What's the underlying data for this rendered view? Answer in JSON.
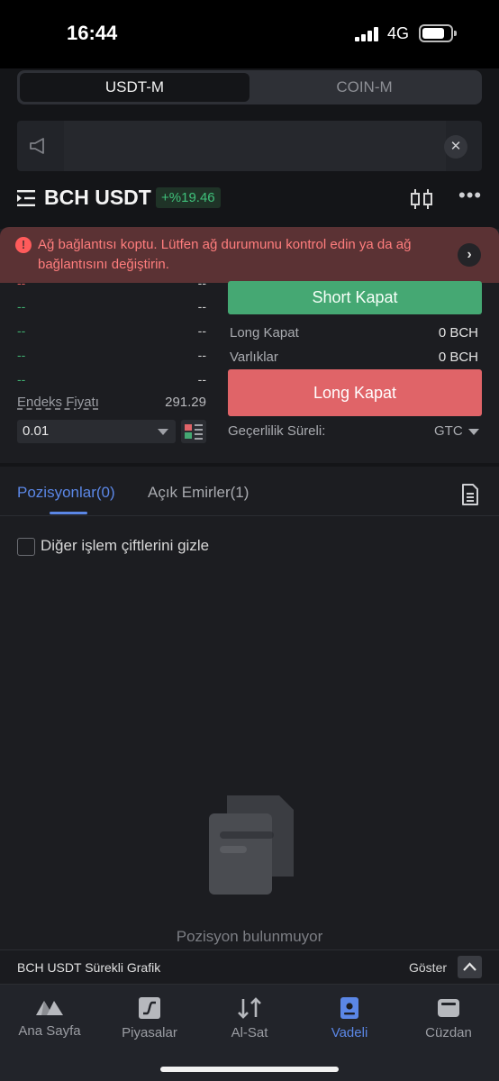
{
  "status_bar": {
    "time": "16:44",
    "network": "4G"
  },
  "segment": {
    "tabs": [
      "USDT-M",
      "COIN-M"
    ],
    "active": "USDT-M"
  },
  "announcement": {
    "close_symbol": "✕"
  },
  "pair": {
    "name": "BCH USDT",
    "change": "+%19.46"
  },
  "alert": {
    "message": "Ağ bağlantısı koptu. Lütfen ağ durumunu kontrol edin ya da ağ bağlantısını değiştirin.",
    "icon_symbol": "!",
    "arrow_symbol": "›"
  },
  "order_book": {
    "rows": [
      {
        "price": "--",
        "amount": "--",
        "side": "sell"
      },
      {
        "price": "--",
        "amount": "--",
        "side": "buy"
      },
      {
        "price": "--",
        "amount": "--",
        "side": "buy"
      },
      {
        "price": "--",
        "amount": "--",
        "side": "buy"
      },
      {
        "price": "--",
        "amount": "--",
        "side": "buy"
      }
    ],
    "index_label": "Endeks Fiyatı",
    "index_value": "291.29",
    "depth": "0.01"
  },
  "trade_panel": {
    "short_close": "Short Kapat",
    "long_close_label": "Long Kapat",
    "long_close_value": "0 BCH",
    "assets_label": "Varlıklar",
    "assets_value": "0 BCH",
    "long_close": "Long Kapat",
    "validity_label": "Geçerlilik Süreli:",
    "validity_value": "GTC"
  },
  "positions": {
    "tab_positions": "Pozisyonlar(0)",
    "tab_orders": "Açık Emirler(1)",
    "hide_pairs": "Diğer işlem çiftlerini gizle",
    "empty": "Pozisyon bulunmuyor"
  },
  "chart_bar": {
    "title": "BCH USDT Sürekli Grafik",
    "show": "Göster"
  },
  "bottom_nav": {
    "items": [
      "Ana Sayfa",
      "Piyasalar",
      "Al-Sat",
      "Vadeli",
      "Cüzdan"
    ],
    "active": "Vadeli"
  },
  "colors": {
    "accent": "#5b87e6",
    "buy_green": "#45a873",
    "sell_red": "#e06468",
    "alert_bg": "#5b3234",
    "alert_text": "#ff7d7d"
  },
  "icons": [
    "signal-icon",
    "battery-icon",
    "megaphone-icon",
    "close-icon",
    "menu-icon",
    "candlestick-icon",
    "more-icon",
    "alert-icon",
    "chevron-right-icon",
    "dropdown-icon",
    "layout-icon",
    "document-icon",
    "empty-documents-icon",
    "chevron-up-icon",
    "home-icon",
    "markets-icon",
    "trade-icon",
    "futures-icon",
    "wallet-icon"
  ]
}
